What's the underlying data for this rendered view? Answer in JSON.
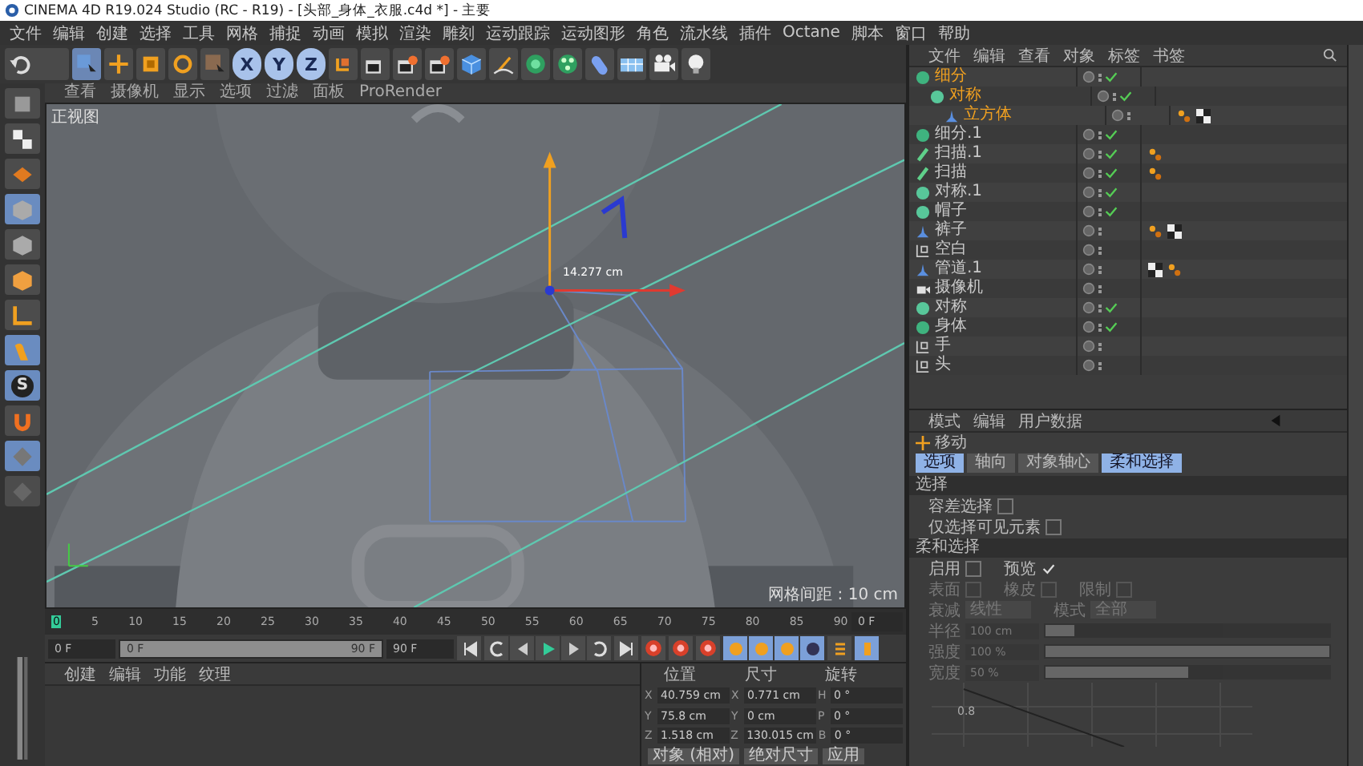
{
  "window": {
    "title": "CINEMA 4D R19.024 Studio (RC - R19) - [头部_身体_衣服.c4d *] - 主要"
  },
  "menu": [
    "文件",
    "编辑",
    "创建",
    "选择",
    "工具",
    "网格",
    "捕捉",
    "动画",
    "模拟",
    "渲染",
    "雕刻",
    "运动跟踪",
    "运动图形",
    "角色",
    "流水线",
    "插件",
    "Octane",
    "脚本",
    "窗口",
    "帮助"
  ],
  "toolbar": {
    "axes": [
      {
        "label": "X",
        "selected": true
      },
      {
        "label": "Y",
        "selected": true
      },
      {
        "label": "Z",
        "selected": true
      }
    ]
  },
  "toolbox": [
    {
      "kind": "model",
      "selected": false
    },
    {
      "kind": "texture",
      "selected": false
    },
    {
      "kind": "workplane",
      "selected": false
    },
    {
      "kind": "points",
      "selected": true
    },
    {
      "kind": "edges",
      "selected": false
    },
    {
      "kind": "polygons",
      "selected": false
    },
    {
      "kind": "axis",
      "selected": false
    },
    {
      "kind": "tweak",
      "selected": true
    },
    {
      "kind": "snap",
      "selected": true,
      "label": "S"
    },
    {
      "kind": "magnet",
      "selected": false
    },
    {
      "kind": "lock",
      "selected": true
    },
    {
      "kind": "plane",
      "selected": false
    }
  ],
  "viewport": {
    "menu": [
      "查看",
      "摄像机",
      "显示",
      "选项",
      "过滤",
      "面板",
      "ProRender"
    ],
    "view_name": "正视图",
    "measure": "14.277 cm",
    "grid_spacing": "网格间距 : 10 cm"
  },
  "timeline": {
    "ticks": [
      "0",
      "5",
      "10",
      "15",
      "20",
      "25",
      "30",
      "35",
      "40",
      "45",
      "50",
      "55",
      "60",
      "65",
      "70",
      "75",
      "80",
      "85",
      "90"
    ],
    "current": "0 F"
  },
  "playback": {
    "start": "0 F",
    "range": {
      "start": "0 F",
      "end": "90 F",
      "level": 1
    },
    "end": "90 F"
  },
  "material_manager": {
    "menu": [
      "创建",
      "编辑",
      "功能",
      "纹理"
    ]
  },
  "coordinates": {
    "headers": [
      "位置",
      "尺寸",
      "旋转"
    ],
    "rows": [
      [
        {
          "axis": "X",
          "value": "40.759 cm"
        },
        {
          "axis": "X",
          "value": "0.771 cm"
        },
        {
          "axis": "H",
          "value": "0 °"
        }
      ],
      [
        {
          "axis": "Y",
          "value": "75.8 cm"
        },
        {
          "axis": "Y",
          "value": "0 cm"
        },
        {
          "axis": "P",
          "value": "0 °"
        }
      ],
      [
        {
          "axis": "Z",
          "value": "1.518 cm"
        },
        {
          "axis": "Z",
          "value": "130.015 cm"
        },
        {
          "axis": "B",
          "value": "0 °"
        }
      ]
    ],
    "buttons": [
      "对象 (相对)",
      "绝对尺寸",
      "应用"
    ]
  },
  "object_manager": {
    "menu": [
      "文件",
      "编辑",
      "查看",
      "对象",
      "标签",
      "书签"
    ],
    "objects": [
      {
        "name": "细分",
        "kind": "generator",
        "selected": true,
        "enabled": true,
        "children": [
          {
            "name": "对称",
            "kind": "symmetry",
            "selected": true,
            "enabled": true,
            "children": [
              {
                "name": "立方体",
                "kind": "polygon",
                "selected": true,
                "enabled": false,
                "tags": [
                  {
                    "kind": "phong"
                  },
                  {
                    "kind": "material"
                  }
                ]
              }
            ]
          }
        ]
      },
      {
        "name": "细分.1",
        "kind": "generator",
        "selected": false,
        "enabled": true
      },
      {
        "name": "扫描.1",
        "kind": "sweep",
        "selected": false,
        "enabled": true,
        "tags": [
          {
            "kind": "phong"
          }
        ]
      },
      {
        "name": "扫描",
        "kind": "sweep",
        "selected": false,
        "enabled": true,
        "tags": [
          {
            "kind": "phong"
          }
        ]
      },
      {
        "name": "对称.1",
        "kind": "symmetry",
        "selected": false,
        "enabled": true
      },
      {
        "name": "帽子",
        "kind": "symmetry",
        "selected": false,
        "enabled": true
      },
      {
        "name": "裤子",
        "kind": "polygon",
        "selected": false,
        "enabled": false,
        "tags": [
          {
            "kind": "phong"
          },
          {
            "kind": "material"
          }
        ]
      },
      {
        "name": "空白",
        "kind": "null",
        "selected": false,
        "enabled": false
      },
      {
        "name": "管道.1",
        "kind": "polygon",
        "selected": false,
        "enabled": false,
        "tags": [
          {
            "kind": "material"
          },
          {
            "kind": "phong"
          }
        ]
      },
      {
        "name": "摄像机",
        "kind": "camera",
        "selected": false,
        "enabled": false
      },
      {
        "name": "对称",
        "kind": "symmetry",
        "selected": false,
        "enabled": true
      },
      {
        "name": "身体",
        "kind": "generator",
        "selected": false,
        "enabled": true
      },
      {
        "name": "手",
        "kind": "null",
        "selected": false,
        "enabled": false
      },
      {
        "name": "头",
        "kind": "null",
        "selected": false,
        "enabled": false
      }
    ]
  },
  "attributes": {
    "menu": [
      "模式",
      "编辑",
      "用户数据"
    ],
    "title": "移动",
    "tabs": [
      {
        "label": "选项",
        "selected": true
      },
      {
        "label": "轴向",
        "selected": false
      },
      {
        "label": "对象轴心",
        "selected": false
      },
      {
        "label": "柔和选择",
        "selected": true
      }
    ],
    "sections": [
      {
        "title": "选择",
        "rows": [
          {
            "kind": "checks",
            "items": [
              {
                "label": "容差选择",
                "checked": false,
                "disabled": false
              }
            ]
          },
          {
            "kind": "checks",
            "items": [
              {
                "label": "仅选择可见元素",
                "checked": false,
                "disabled": false
              }
            ]
          }
        ]
      },
      {
        "title": "柔和选择",
        "rows": [
          {
            "kind": "checks",
            "items": [
              {
                "label": "启用",
                "checked": false,
                "disabled": false
              },
              {
                "label": "预览",
                "checked": true,
                "disabled": false
              }
            ]
          },
          {
            "kind": "checks",
            "items": [
              {
                "label": "表面",
                "checked": false,
                "disabled": true
              },
              {
                "label": "橡皮",
                "checked": false,
                "disabled": true
              },
              {
                "label": "限制",
                "checked": false,
                "disabled": true
              }
            ]
          },
          {
            "kind": "dropdowns",
            "items": [
              {
                "label": "衰减",
                "value": "线性",
                "disabled": true
              },
              {
                "label": "模式",
                "value": "全部",
                "disabled": true
              }
            ]
          },
          {
            "kind": "slider",
            "label": "半径",
            "value": "100 cm",
            "level": 0.1,
            "disabled": true
          },
          {
            "kind": "slider",
            "label": "强度",
            "value": "100 %",
            "level": 1,
            "disabled": true
          },
          {
            "kind": "slider",
            "label": "宽度",
            "value": "50 %",
            "level": 0.5,
            "disabled": true
          }
        ]
      }
    ],
    "graph_label": "0.8"
  }
}
